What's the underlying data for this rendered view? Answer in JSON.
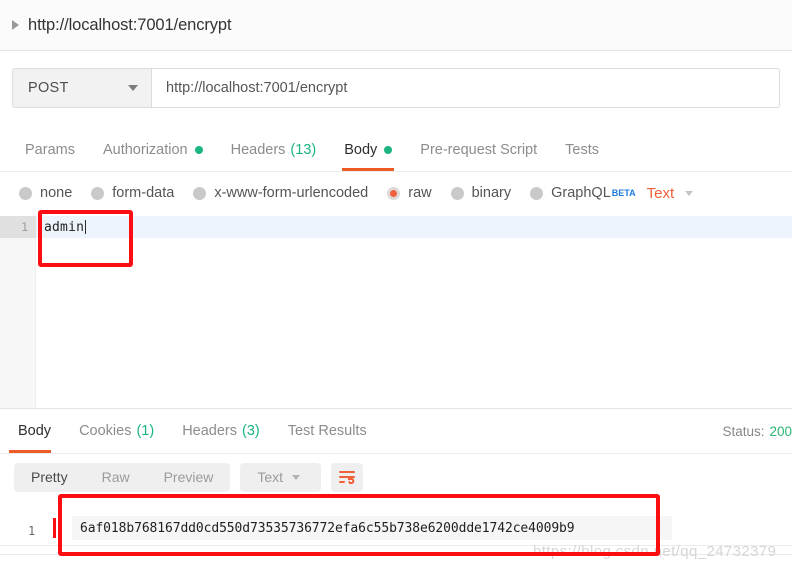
{
  "titlebar": {
    "request_name": "http://localhost:7001/encrypt",
    "disclosure_icon": "triangle-right-icon"
  },
  "request": {
    "method": "POST",
    "method_caret_icon": "chevron-down-icon",
    "url": "http://localhost:7001/encrypt"
  },
  "request_tabs": [
    {
      "label": "Params",
      "badge": "",
      "dot": false,
      "active": false
    },
    {
      "label": "Authorization",
      "badge": "",
      "dot": true,
      "active": false
    },
    {
      "label": "Headers",
      "badge": "(13)",
      "dot": false,
      "active": false
    },
    {
      "label": "Body",
      "badge": "",
      "dot": true,
      "active": true
    },
    {
      "label": "Pre-request Script",
      "badge": "",
      "dot": false,
      "active": false
    },
    {
      "label": "Tests",
      "badge": "",
      "dot": false,
      "active": false
    }
  ],
  "body_types": [
    {
      "label": "none",
      "selected": false
    },
    {
      "label": "form-data",
      "selected": false
    },
    {
      "label": "x-www-form-urlencoded",
      "selected": false
    },
    {
      "label": "raw",
      "selected": true
    },
    {
      "label": "binary",
      "selected": false
    },
    {
      "label": "GraphQL",
      "selected": false,
      "superscript": "BETA"
    }
  ],
  "raw_format": {
    "value": "Text",
    "caret_icon": "chevron-down-icon"
  },
  "request_body_editor": {
    "line_number": "1",
    "content": "admin"
  },
  "response_tabs": [
    {
      "label": "Body",
      "badge": "",
      "active": true
    },
    {
      "label": "Cookies",
      "badge": "(1)",
      "active": false
    },
    {
      "label": "Headers",
      "badge": "(3)",
      "active": false
    },
    {
      "label": "Test Results",
      "badge": "",
      "active": false
    }
  ],
  "response_status": {
    "label": "Status:",
    "code": "200"
  },
  "response_toolbar": {
    "views": [
      {
        "label": "Pretty",
        "active": true
      },
      {
        "label": "Raw",
        "active": false
      },
      {
        "label": "Preview",
        "active": false
      }
    ],
    "format": "Text",
    "format_caret_icon": "chevron-down-icon",
    "wrap_button_icon": "word-wrap-icon"
  },
  "response_body": {
    "line_number": "1",
    "value": "6af018b768167dd0cd550d73535736772efa6c55b738e6200dde1742ce4009b9"
  },
  "annotations": {
    "highlight_color": "#fc0d11",
    "boxes": [
      {
        "name": "request-body-highlight"
      },
      {
        "name": "response-body-highlight"
      }
    ]
  },
  "watermark": {
    "text": "https://blog.csdn.net/qq_24732379"
  },
  "colors": {
    "accent_orange": "#ef5b25",
    "success_green": "#1bb580",
    "status_green": "#2bb673",
    "beta_blue": "#1f7ae0",
    "annotation_red": "#fc0d11"
  }
}
